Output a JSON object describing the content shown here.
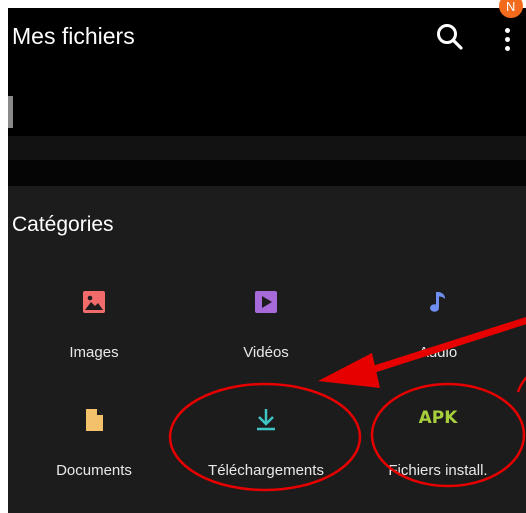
{
  "app": {
    "title": "Mes fichiers"
  },
  "badge": {
    "new_label": "N"
  },
  "categories": {
    "title": "Catégories",
    "items": [
      {
        "label": "Images",
        "icon": "image-icon",
        "color": "#f26b6b"
      },
      {
        "label": "Vidéos",
        "icon": "video-icon",
        "color": "#a86ad8"
      },
      {
        "label": "Audio",
        "icon": "music-note-icon",
        "color": "#6f8ef2"
      },
      {
        "label": "Documents",
        "icon": "document-icon",
        "color": "#f3c06b"
      },
      {
        "label": "Téléchargements",
        "icon": "download-icon",
        "color": "#3fc5c5"
      },
      {
        "label": "Fichiers install.",
        "icon": "apk-icon",
        "icon_text": "APK",
        "color": "#a7cf3c"
      }
    ]
  },
  "annotations": {
    "highlight_color": "#e60000",
    "arrow_color": "#e60000"
  }
}
